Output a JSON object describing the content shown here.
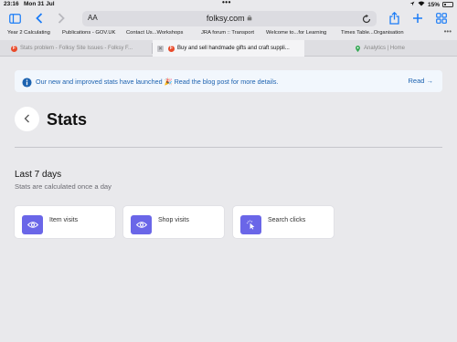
{
  "status_bar": {
    "time": "23:16",
    "date": "Mon 31 Jul",
    "battery": "15%"
  },
  "browser": {
    "url": "folksy.com",
    "text_size": "AA",
    "bookmarks": [
      "Year 2 Calculating",
      "Publications - GOV.UK",
      "Contact Us...Workshops",
      "JRA forum :: Transport",
      "Welcome to...for Learning",
      "Times Table...Organisation"
    ],
    "tabs": [
      "Stats problem - Folksy Site Issues - Folksy F...",
      "Buy and sell handmade gifts and craft suppli...",
      "Analytics | Home"
    ]
  },
  "banner": {
    "message": "Our new and improved stats have launched 🎉 Read the blog post for more details.",
    "link": "Read →"
  },
  "page": {
    "title": "Stats",
    "section_title": "Last 7 days",
    "section_subtitle": "Stats are calculated once a day"
  },
  "cards": [
    {
      "label": "Item visits",
      "icon": "eye-icon"
    },
    {
      "label": "Shop visits",
      "icon": "eye-icon"
    },
    {
      "label": "Search clicks",
      "icon": "cursor-click-icon"
    }
  ],
  "colors": {
    "accent": "#1b7cf6",
    "card_icon": "#6a66e8",
    "banner_text": "#1c62b0",
    "favicon": "#e94b2b"
  }
}
